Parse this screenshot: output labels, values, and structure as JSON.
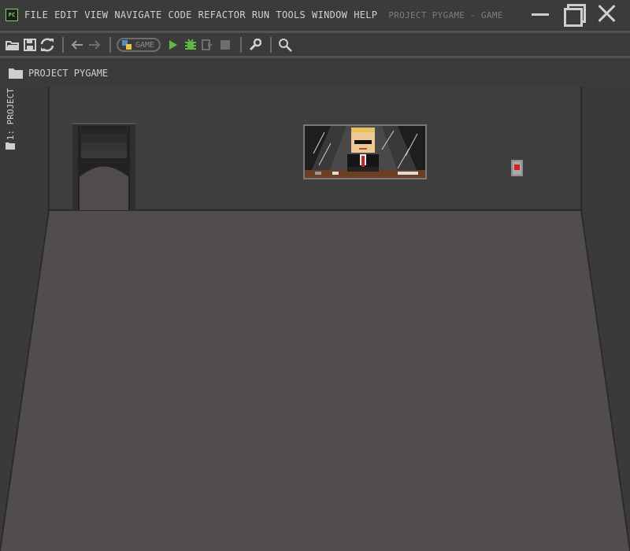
{
  "app": {
    "icon_text": "PC",
    "window_title": "PROJECT PYGAME - GAME"
  },
  "menu": {
    "items": [
      "FILE",
      "EDIT",
      "VIEW",
      "NAVIGATE",
      "CODE",
      "REFACTOR",
      "RUN",
      "TOOLS",
      "WINDOW",
      "HELP"
    ]
  },
  "toolbar": {
    "run_config_label": "GAME"
  },
  "project_bar": {
    "breadcrumb": "PROJECT PYGAME"
  },
  "side_tab": {
    "label": "1: PROJECT"
  },
  "colors": {
    "background": "#3c3b3b",
    "floor": "#514d4d",
    "back_wall": "#3f3e3e",
    "side_wall": "#3b3a3a",
    "accent_green": "#7fd35a",
    "alarm_red": "#d62020"
  },
  "scene": {
    "objects": [
      "doorway",
      "framed-picture-agent",
      "wall-alarm-button"
    ]
  }
}
